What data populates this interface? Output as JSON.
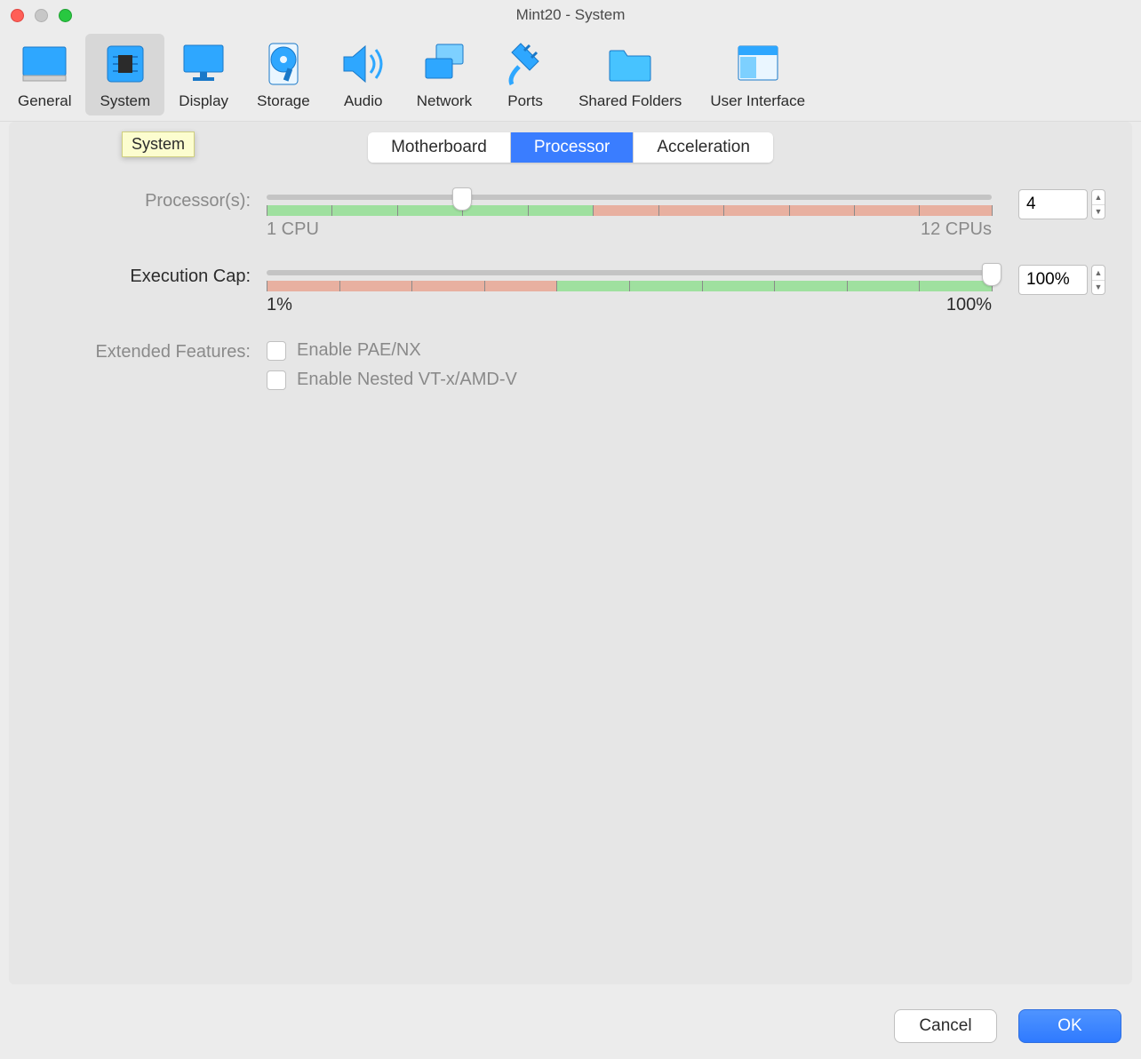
{
  "window": {
    "title": "Mint20 - System"
  },
  "tooltip": "System",
  "toolbar": {
    "items": [
      {
        "label": "General"
      },
      {
        "label": "System"
      },
      {
        "label": "Display"
      },
      {
        "label": "Storage"
      },
      {
        "label": "Audio"
      },
      {
        "label": "Network"
      },
      {
        "label": "Ports"
      },
      {
        "label": "Shared Folders"
      },
      {
        "label": "User Interface"
      }
    ]
  },
  "tabs": {
    "motherboard": "Motherboard",
    "processor": "Processor",
    "acceleration": "Acceleration"
  },
  "processors": {
    "label": "Processor(s):",
    "min_label": "1 CPU",
    "max_label": "12 CPUs",
    "value": "4",
    "green_pct": 45,
    "thumb_pct": 27
  },
  "execution_cap": {
    "label": "Execution Cap:",
    "min_label": "1%",
    "max_label": "100%",
    "value": "100%",
    "red_pct": 40,
    "thumb_pct": 100
  },
  "extended": {
    "label": "Extended Features:",
    "pae": "Enable PAE/NX",
    "nested": "Enable Nested VT-x/AMD-V"
  },
  "buttons": {
    "cancel": "Cancel",
    "ok": "OK"
  }
}
